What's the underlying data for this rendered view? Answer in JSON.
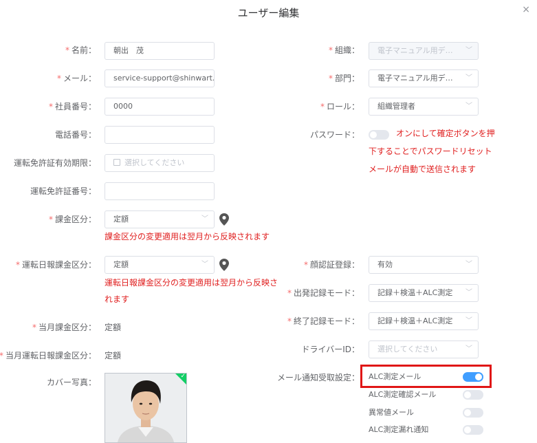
{
  "dialog": {
    "title": "ユーザー編集",
    "close": "×"
  },
  "required_mark": "*",
  "left": {
    "name": {
      "label": "名前：",
      "value": "朝出　茂"
    },
    "email": {
      "label": "メール：",
      "value": "service-support@shinwart.co"
    },
    "employee_no": {
      "label": "社員番号：",
      "value": "0000"
    },
    "phone": {
      "label": "電話番号：",
      "value": ""
    },
    "license_expiry": {
      "label": "運転免許証有効期限：",
      "placeholder": "選択してください"
    },
    "license_no": {
      "label": "運転免許証番号：",
      "value": ""
    },
    "billing": {
      "label": "課金区分：",
      "value": "定額",
      "warning": "課金区分の変更適用は翌月から反映されます"
    },
    "daily_billing": {
      "label": "運転日報課金区分：",
      "value": "定額",
      "warning_line1": "運転日報課金区分の変更適用は翌月から反映さ",
      "warning_line2": "れます"
    },
    "current_billing": {
      "label": "当月課金区分：",
      "value": "定額"
    },
    "current_daily_billing": {
      "label": "当月運転日報課金区分：",
      "value": "定額"
    },
    "cover_photo": {
      "label": "カバー写真："
    }
  },
  "right": {
    "org": {
      "label": "組織：",
      "value": "電子マニュアル用デモサイト"
    },
    "dept": {
      "label": "部門：",
      "value": "電子マニュアル用デモ..."
    },
    "role": {
      "label": "ロール：",
      "value": "組織管理者"
    },
    "password": {
      "label": "パスワード：",
      "note_line1": "オンにして確定ボタンを押",
      "note_line2": "下することでパスワードリセット",
      "note_line3": "メールが自動で送信されます"
    },
    "face_auth": {
      "label": "顔認証登録：",
      "value": "有効"
    },
    "departure_mode": {
      "label": "出発記録モード：",
      "value": "記録＋検温＋ALC測定"
    },
    "end_mode": {
      "label": "終了記録モード：",
      "value": "記録＋検温＋ALC測定"
    },
    "driver_id": {
      "label": "ドライバーID：",
      "placeholder": "選択してください"
    },
    "notifications": {
      "label": "メール通知受取設定：",
      "items": [
        {
          "label": "ALC測定メール",
          "on": true
        },
        {
          "label": "ALC測定確認メール",
          "on": false
        },
        {
          "label": "異常値メール",
          "on": false
        },
        {
          "label": "ALC測定漏れ通知",
          "on": false
        }
      ]
    }
  },
  "colors": {
    "required": "#f56c6c",
    "warning": "#e02020",
    "toggle_on": "#409eff",
    "highlight": "#e01616"
  },
  "icons": {
    "location": "location-pin-icon",
    "chevron": "chevron-down-icon",
    "calendar": "calendar-icon",
    "check": "check-icon"
  }
}
